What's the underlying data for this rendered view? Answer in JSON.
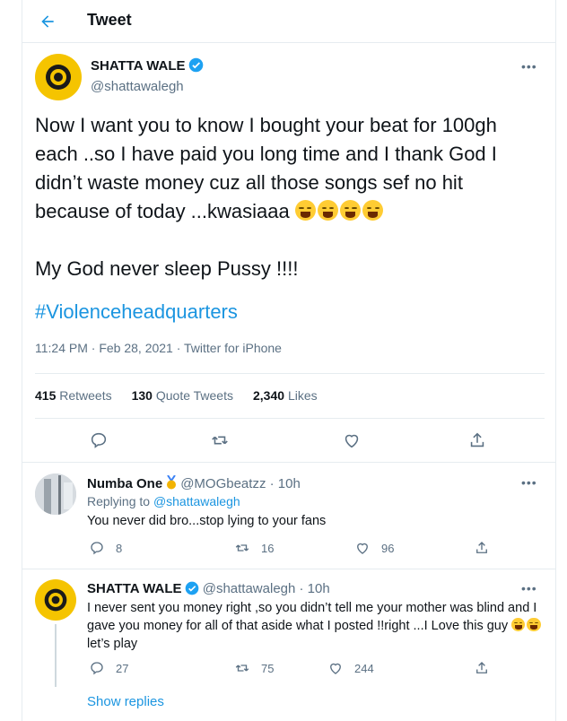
{
  "header": {
    "title": "Tweet"
  },
  "main_tweet": {
    "author_name": "SHATTA WALE",
    "author_handle": "@shattawalegh",
    "text": "Now I want you to know I bought your beat for 100gh each ..so I have paid you long time and I thank God I didn’t waste money cuz all those songs sef no hit because of today ...kwasiaaa",
    "text2": "My God never sleep Pussy !!!!",
    "hashtag": "#Violenceheadquarters",
    "meta": "11:24 PM · Feb 28, 2021 · Twitter for iPhone",
    "retweets_count": "415",
    "retweets_label": "Retweets",
    "quote_count": "130",
    "quote_label": "Quote Tweets",
    "likes_count": "2,340",
    "likes_label": "Likes"
  },
  "reply1": {
    "author_name": "Numba One",
    "author_handle": "@MOGbeatzz",
    "time": "· 10h",
    "replying_prefix": "Replying to",
    "replying_to": "@shattawalegh",
    "text": "You never did bro...stop lying to your fans",
    "reply_count": "8",
    "retweet_count": "16",
    "like_count": "96"
  },
  "reply2": {
    "author_name": "SHATTA WALE",
    "author_handle": "@shattawalegh",
    "time": "· 10h",
    "text": "I never sent you money right ,so you didn’t tell me your mother was blind and I gave you money for all of that aside what I posted !!right ...I Love this guy",
    "text_tail": "let’s play",
    "reply_count": "27",
    "retweet_count": "75",
    "like_count": "244"
  },
  "show_replies": "Show replies",
  "icons": {
    "back": "back-arrow-icon",
    "verified": "verified-badge-icon",
    "more": "more-options-icon",
    "reply": "reply-icon",
    "retweet": "retweet-icon",
    "like": "like-icon",
    "share": "share-icon",
    "emoji": "tears-of-joy-emoji-icon",
    "medal": "medal-icon"
  },
  "colors": {
    "accent": "#1b95e0",
    "secondary_text": "#5b7083",
    "avatar_yellow": "#f5c400"
  }
}
